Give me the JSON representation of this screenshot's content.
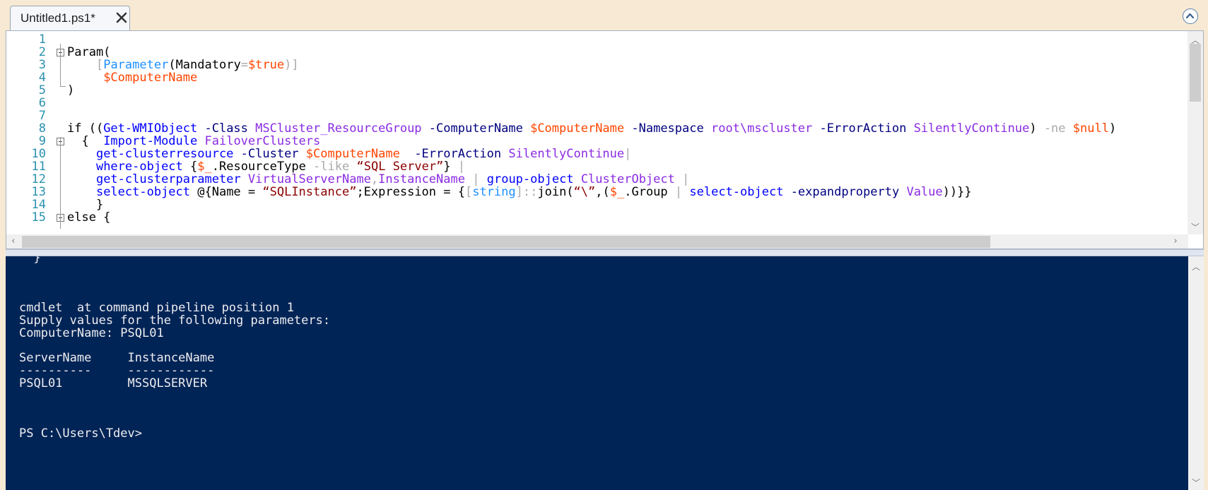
{
  "tab": {
    "title": "Untitled1.ps1*"
  },
  "editor": {
    "lines": [
      {
        "n": "1",
        "tokens": []
      },
      {
        "n": "2",
        "tokens": [
          {
            "t": "Param(",
            "c": "tk-plain"
          }
        ]
      },
      {
        "n": "3",
        "tokens": [
          {
            "t": "    ",
            "c": "tk-plain"
          },
          {
            "t": "[",
            "c": "tk-op"
          },
          {
            "t": "Parameter",
            "c": "tk-type"
          },
          {
            "t": "(Mandatory",
            "c": "tk-plain"
          },
          {
            "t": "=",
            "c": "tk-op"
          },
          {
            "t": "$true",
            "c": "tk-var"
          },
          {
            "t": ")]",
            "c": "tk-op"
          }
        ]
      },
      {
        "n": "4",
        "tokens": [
          {
            "t": "     ",
            "c": "tk-plain"
          },
          {
            "t": "$ComputerName",
            "c": "tk-var"
          }
        ]
      },
      {
        "n": "5",
        "tokens": [
          {
            "t": ")",
            "c": "tk-plain"
          }
        ]
      },
      {
        "n": "6",
        "tokens": []
      },
      {
        "n": "7",
        "tokens": []
      },
      {
        "n": "8",
        "tokens": [
          {
            "t": "if ((",
            "c": "tk-plain"
          },
          {
            "t": "Get-WMIObject",
            "c": "tk-cmd"
          },
          {
            "t": " -Class ",
            "c": "tk-param"
          },
          {
            "t": "MSCluster_ResourceGroup",
            "c": "tk-arg"
          },
          {
            "t": " -ComputerName ",
            "c": "tk-param"
          },
          {
            "t": "$ComputerName",
            "c": "tk-var"
          },
          {
            "t": " -Namespace ",
            "c": "tk-param"
          },
          {
            "t": "root\\mscluster",
            "c": "tk-arg"
          },
          {
            "t": " -ErrorAction ",
            "c": "tk-param"
          },
          {
            "t": "SilentlyContinue",
            "c": "tk-arg"
          },
          {
            "t": ") ",
            "c": "tk-plain"
          },
          {
            "t": "-ne",
            "c": "tk-op"
          },
          {
            "t": " ",
            "c": "tk-plain"
          },
          {
            "t": "$null",
            "c": "tk-var"
          },
          {
            "t": ")",
            "c": "tk-plain"
          }
        ]
      },
      {
        "n": "9",
        "tokens": [
          {
            "t": "  {  ",
            "c": "tk-plain"
          },
          {
            "t": "Import-Module",
            "c": "tk-cmd"
          },
          {
            "t": " ",
            "c": "tk-plain"
          },
          {
            "t": "FailoverClusters",
            "c": "tk-arg"
          }
        ]
      },
      {
        "n": "10",
        "tokens": [
          {
            "t": "    ",
            "c": "tk-plain"
          },
          {
            "t": "get-clusterresource",
            "c": "tk-cmd"
          },
          {
            "t": " -Cluster ",
            "c": "tk-param"
          },
          {
            "t": "$ComputerName",
            "c": "tk-var"
          },
          {
            "t": "  -ErrorAction ",
            "c": "tk-param"
          },
          {
            "t": "SilentlyContinue",
            "c": "tk-arg"
          },
          {
            "t": "|",
            "c": "tk-op"
          }
        ]
      },
      {
        "n": "11",
        "tokens": [
          {
            "t": "    ",
            "c": "tk-plain"
          },
          {
            "t": "where-object",
            "c": "tk-cmd"
          },
          {
            "t": " {",
            "c": "tk-plain"
          },
          {
            "t": "$_",
            "c": "tk-var"
          },
          {
            "t": ".ResourceType ",
            "c": "tk-plain"
          },
          {
            "t": "-like",
            "c": "tk-op"
          },
          {
            "t": " ",
            "c": "tk-plain"
          },
          {
            "t": "“SQL Server”",
            "c": "tk-str"
          },
          {
            "t": "} ",
            "c": "tk-plain"
          },
          {
            "t": "|",
            "c": "tk-op"
          }
        ]
      },
      {
        "n": "12",
        "tokens": [
          {
            "t": "    ",
            "c": "tk-plain"
          },
          {
            "t": "get-clusterparameter",
            "c": "tk-cmd"
          },
          {
            "t": " ",
            "c": "tk-plain"
          },
          {
            "t": "VirtualServerName",
            "c": "tk-arg"
          },
          {
            "t": ",",
            "c": "tk-op"
          },
          {
            "t": "InstanceName",
            "c": "tk-arg"
          },
          {
            "t": " ",
            "c": "tk-plain"
          },
          {
            "t": "|",
            "c": "tk-op"
          },
          {
            "t": " ",
            "c": "tk-plain"
          },
          {
            "t": "group-object",
            "c": "tk-cmd"
          },
          {
            "t": " ",
            "c": "tk-plain"
          },
          {
            "t": "ClusterObject",
            "c": "tk-arg"
          },
          {
            "t": " ",
            "c": "tk-plain"
          },
          {
            "t": "|",
            "c": "tk-op"
          }
        ]
      },
      {
        "n": "13",
        "tokens": [
          {
            "t": "    ",
            "c": "tk-plain"
          },
          {
            "t": "select-object",
            "c": "tk-cmd"
          },
          {
            "t": " @{Name = ",
            "c": "tk-plain"
          },
          {
            "t": "“SQLInstance”",
            "c": "tk-str"
          },
          {
            "t": ";Expression = {",
            "c": "tk-plain"
          },
          {
            "t": "[",
            "c": "tk-op"
          },
          {
            "t": "string",
            "c": "tk-type"
          },
          {
            "t": "]::",
            "c": "tk-op"
          },
          {
            "t": "join(",
            "c": "tk-plain"
          },
          {
            "t": "“\\”",
            "c": "tk-str"
          },
          {
            "t": ",(",
            "c": "tk-plain"
          },
          {
            "t": "$_",
            "c": "tk-var"
          },
          {
            "t": ".Group ",
            "c": "tk-plain"
          },
          {
            "t": "|",
            "c": "tk-op"
          },
          {
            "t": " ",
            "c": "tk-plain"
          },
          {
            "t": "select-object",
            "c": "tk-cmd"
          },
          {
            "t": " -expandproperty ",
            "c": "tk-param"
          },
          {
            "t": "Value",
            "c": "tk-arg"
          },
          {
            "t": "))}}",
            "c": "tk-plain"
          }
        ]
      },
      {
        "n": "14",
        "tokens": [
          {
            "t": "    }",
            "c": "tk-plain"
          }
        ]
      },
      {
        "n": "15",
        "tokens": [
          {
            "t": "else {",
            "c": "tk-plain"
          }
        ]
      }
    ]
  },
  "console": {
    "lines": [
      "   }",
      "  }",
      "",
      "",
      "",
      "cmdlet  at command pipeline position 1",
      "Supply values for the following parameters:",
      "ComputerName: PSQL01",
      "",
      "ServerName     InstanceName",
      "----------     ------------",
      "PSQL01         MSSQLSERVER",
      "",
      "",
      "",
      "PS C:\\Users\\Tdev>"
    ]
  },
  "icons": {
    "close": "close-icon",
    "collapse": "chevron-up-circle-icon"
  }
}
